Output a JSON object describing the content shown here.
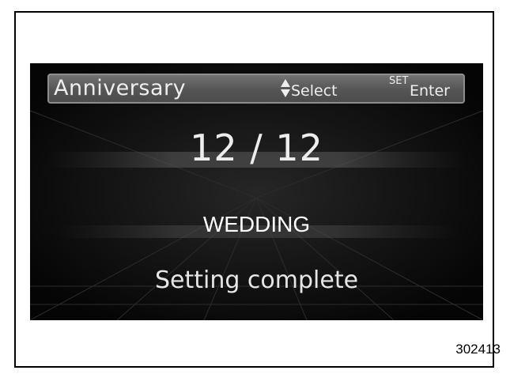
{
  "header": {
    "title": "Anniversary",
    "select_label": "Select",
    "set_key_label": "SET",
    "enter_label": "Enter",
    "select_icon": "up-down-arrows-icon"
  },
  "main": {
    "date": "12 / 12",
    "event_type": "WEDDING",
    "status": "Setting complete"
  },
  "figure": {
    "id": "302413"
  },
  "colors": {
    "screen_background": "#0b0b0b",
    "header_bar": "#5c5c5c",
    "text": "#eeeeee",
    "frame_border": "#000000"
  }
}
